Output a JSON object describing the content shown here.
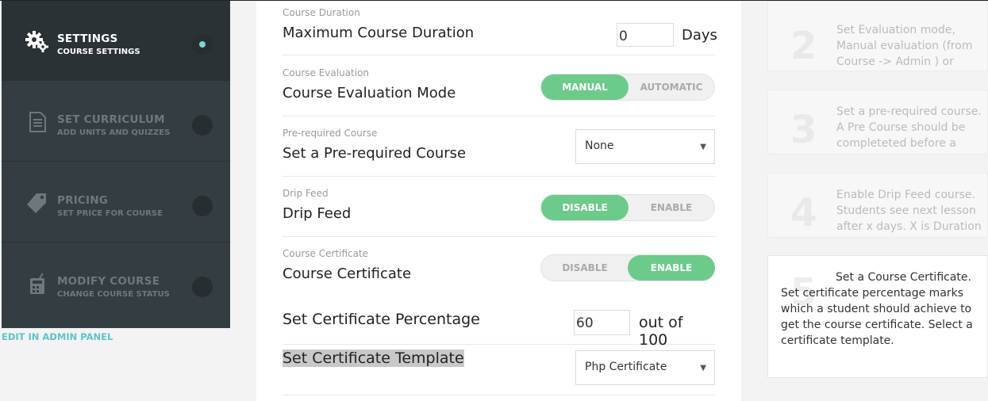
{
  "sidebar": {
    "steps": [
      {
        "title": "SETTINGS",
        "subtitle": "COURSE SETTINGS",
        "icon": "gears-icon",
        "active": true
      },
      {
        "title": "SET CURRICULUM",
        "subtitle": "ADD UNITS AND QUIZZES",
        "icon": "document-icon",
        "active": false
      },
      {
        "title": "PRICING",
        "subtitle": "SET PRICE FOR COURSE",
        "icon": "price-tag-icon",
        "active": false
      },
      {
        "title": "MODIFY COURSE",
        "subtitle": "CHANGE COURSE STATUS",
        "icon": "calculator-icon",
        "active": false
      }
    ],
    "admin_link": "EDIT IN ADMIN PANEL"
  },
  "settings": {
    "duration": {
      "small": "Course Duration",
      "label": "Maximum Course Duration",
      "value": "0",
      "unit": "Days"
    },
    "evaluation": {
      "small": "Course Evaluation",
      "label": "Course Evaluation Mode",
      "options": [
        "MANUAL",
        "AUTOMATIC"
      ],
      "selected": "MANUAL"
    },
    "prerequisite": {
      "small": "Pre-required Course",
      "label": "Set a Pre-required Course",
      "selected": "None"
    },
    "drip": {
      "small": "Drip Feed",
      "label": "Drip Feed",
      "options": [
        "DISABLE",
        "ENABLE"
      ],
      "selected": "DISABLE"
    },
    "certificate": {
      "small": "Course Certificate",
      "label": "Course Certificate",
      "options": [
        "DISABLE",
        "ENABLE"
      ],
      "selected": "ENABLE"
    },
    "percentage": {
      "label": "Set Certificate Percentage",
      "value": "60",
      "unit": "out of 100"
    },
    "template": {
      "label": "Set Certificate Template",
      "selected": "Php Certificate"
    }
  },
  "help": [
    {
      "num": "2",
      "text": "Set Evaluation mode, Manual evaluation (from Course -> Admin ) or"
    },
    {
      "num": "3",
      "text": "Set a pre-required course. A Pre Course should be completeted before a"
    },
    {
      "num": "4",
      "text": "Enable Drip Feed course. Students see next lesson after x days. X is Duration"
    },
    {
      "num": "5",
      "text": "Set a Course Certificate. Set certificate percentage marks which a student should achieve to get the course certificate. Select a certificate template."
    }
  ],
  "colors": {
    "accent_green": "#6ccb8a",
    "sidebar_bg": "#343d41",
    "active_dot": "#7fd4d3",
    "link": "#5dc4c8"
  }
}
